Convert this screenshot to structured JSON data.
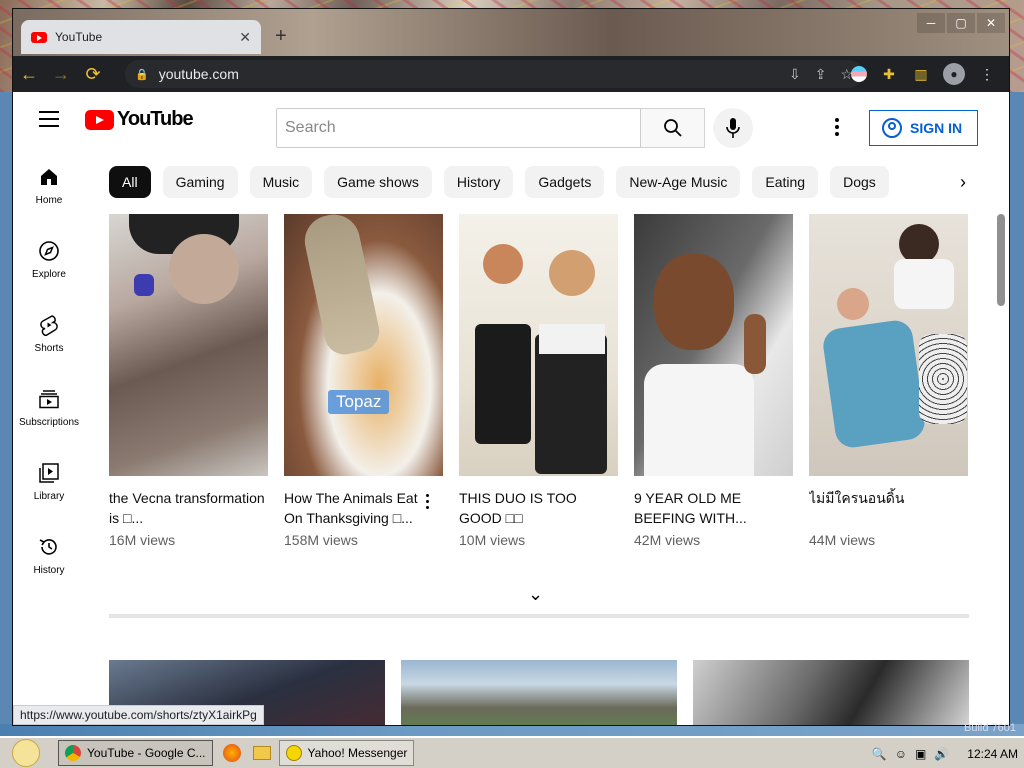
{
  "browser": {
    "tab_title": "YouTube",
    "address": "youtube.com",
    "status_url": "https://www.youtube.com/shorts/ztyX1airkPg"
  },
  "youtube": {
    "logo_text": "YouTube",
    "search_placeholder": "Search",
    "signin_label": "SIGN IN",
    "chips": [
      "All",
      "Gaming",
      "Music",
      "Game shows",
      "History",
      "Gadgets",
      "New-Age Music",
      "Eating",
      "Dogs"
    ],
    "sidebar": [
      {
        "label": "Home",
        "icon": "home-icon"
      },
      {
        "label": "Explore",
        "icon": "compass-icon"
      },
      {
        "label": "Shorts",
        "icon": "shorts-icon"
      },
      {
        "label": "Subscriptions",
        "icon": "subscriptions-icon"
      },
      {
        "label": "Library",
        "icon": "library-icon"
      },
      {
        "label": "History",
        "icon": "history-icon"
      }
    ],
    "shorts": [
      {
        "title": "the Vecna transformation is □...",
        "views": "16M views"
      },
      {
        "title": "How The Animals Eat On Thanksgiving □...",
        "views": "158M views",
        "overlay": "Topaz"
      },
      {
        "title": "THIS DUO IS TOO GOOD □□",
        "views": "10M views"
      },
      {
        "title": "9 YEAR OLD ME BEEFING WITH...",
        "views": "42M views"
      },
      {
        "title": "ไม่มีใครนอนดิ้น",
        "views": "44M views"
      }
    ]
  },
  "taskbar": {
    "items": [
      {
        "label": "YouTube - Google C..."
      },
      {
        "label": "Yahoo! Messenger"
      }
    ],
    "clock": "12:24 AM",
    "build_text": "Build 7601"
  }
}
